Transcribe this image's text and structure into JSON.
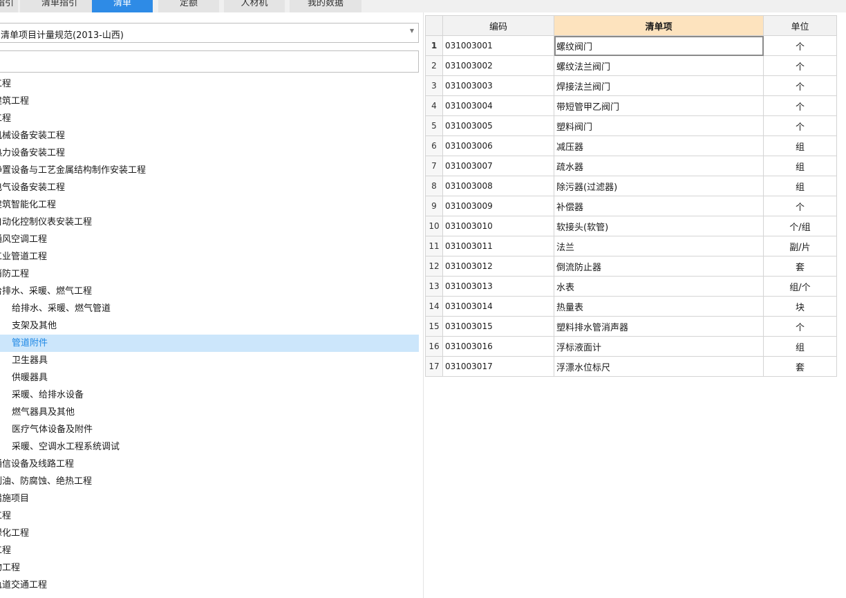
{
  "tabs": [
    {
      "label": "指引",
      "active": false
    },
    {
      "label": "清单指引",
      "active": false
    },
    {
      "label": "清单",
      "active": true
    },
    {
      "label": "定额",
      "active": false
    },
    {
      "label": "人材机",
      "active": false
    },
    {
      "label": "我的数据",
      "active": false
    }
  ],
  "spec_select": {
    "value": "清单项目计量规范(2013-山西)"
  },
  "search": {
    "value": ""
  },
  "tree": [
    {
      "label": "工程",
      "level": 0
    },
    {
      "label": "建筑工程",
      "level": 0
    },
    {
      "label": "工程",
      "level": 0
    },
    {
      "label": "机械设备安装工程",
      "level": 0
    },
    {
      "label": "热力设备安装工程",
      "level": 0
    },
    {
      "label": "静置设备与工艺金属结构制作安装工程",
      "level": 0
    },
    {
      "label": "电气设备安装工程",
      "level": 0
    },
    {
      "label": "建筑智能化工程",
      "level": 0
    },
    {
      "label": "自动化控制仪表安装工程",
      "level": 0
    },
    {
      "label": "通风空调工程",
      "level": 0
    },
    {
      "label": "工业管道工程",
      "level": 0
    },
    {
      "label": "消防工程",
      "level": 0
    },
    {
      "label": "给排水、采暖、燃气工程",
      "level": 0
    },
    {
      "label": "给排水、采暖、燃气管道",
      "level": 1
    },
    {
      "label": "支架及其他",
      "level": 1
    },
    {
      "label": "管道附件",
      "level": 1,
      "selected": true
    },
    {
      "label": "卫生器具",
      "level": 1
    },
    {
      "label": "供暖器具",
      "level": 1
    },
    {
      "label": "采暖、给排水设备",
      "level": 1
    },
    {
      "label": "燃气器具及其他",
      "level": 1
    },
    {
      "label": "医疗气体设备及附件",
      "level": 1
    },
    {
      "label": "采暖、空调水工程系统调试",
      "level": 1
    },
    {
      "label": "通信设备及线路工程",
      "level": 0
    },
    {
      "label": "刷油、防腐蚀、绝热工程",
      "level": 0
    },
    {
      "label": "措施项目",
      "level": 0
    },
    {
      "label": "工程",
      "level": 0
    },
    {
      "label": "绿化工程",
      "level": 0
    },
    {
      "label": "工程",
      "level": 0
    },
    {
      "label": "物工程",
      "level": 0
    },
    {
      "label": "轨道交通工程",
      "level": 0
    }
  ],
  "grid": {
    "headers": {
      "code": "编码",
      "name": "清单项",
      "unit": "单位"
    },
    "rows": [
      {
        "n": "1",
        "code": "031003001",
        "name": "螺纹阀门",
        "unit": "个"
      },
      {
        "n": "2",
        "code": "031003002",
        "name": "螺纹法兰阀门",
        "unit": "个"
      },
      {
        "n": "3",
        "code": "031003003",
        "name": "焊接法兰阀门",
        "unit": "个"
      },
      {
        "n": "4",
        "code": "031003004",
        "name": "带短管甲乙阀门",
        "unit": "个"
      },
      {
        "n": "5",
        "code": "031003005",
        "name": "塑料阀门",
        "unit": "个"
      },
      {
        "n": "6",
        "code": "031003006",
        "name": "减压器",
        "unit": "组"
      },
      {
        "n": "7",
        "code": "031003007",
        "name": "疏水器",
        "unit": "组"
      },
      {
        "n": "8",
        "code": "031003008",
        "name": "除污器(过滤器)",
        "unit": "组"
      },
      {
        "n": "9",
        "code": "031003009",
        "name": "补偿器",
        "unit": "个"
      },
      {
        "n": "10",
        "code": "031003010",
        "name": "软接头(软管)",
        "unit": "个/组"
      },
      {
        "n": "11",
        "code": "031003011",
        "name": "法兰",
        "unit": "副/片"
      },
      {
        "n": "12",
        "code": "031003012",
        "name": "倒流防止器",
        "unit": "套"
      },
      {
        "n": "13",
        "code": "031003013",
        "name": "水表",
        "unit": "组/个"
      },
      {
        "n": "14",
        "code": "031003014",
        "name": "热量表",
        "unit": "块"
      },
      {
        "n": "15",
        "code": "031003015",
        "name": "塑料排水管消声器",
        "unit": "个"
      },
      {
        "n": "16",
        "code": "031003016",
        "name": "浮标液面计",
        "unit": "组"
      },
      {
        "n": "17",
        "code": "031003017",
        "name": "浮漂水位标尺",
        "unit": "套"
      }
    ]
  },
  "colors": {
    "accent": "#2e8be6",
    "selected_bg": "#cce6fb",
    "header_highlight": "#fde3be"
  }
}
